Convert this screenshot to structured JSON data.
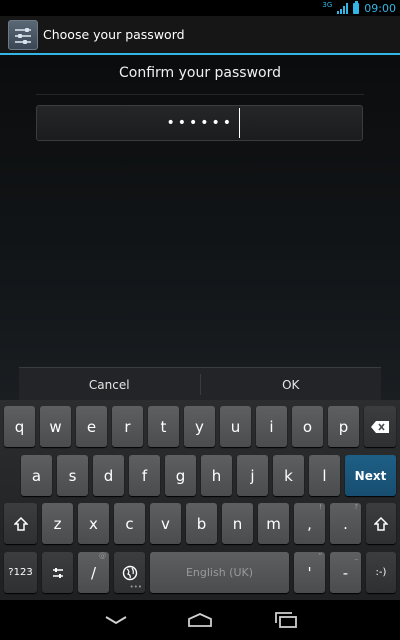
{
  "status_bar": {
    "network": "3G",
    "time": "09:00"
  },
  "action_bar": {
    "title": "Choose your password",
    "icon": "settings-sliders-icon"
  },
  "main": {
    "header": "Confirm your password",
    "password_masked": "••••••",
    "buttons": {
      "cancel": "Cancel",
      "ok": "OK"
    }
  },
  "keyboard": {
    "row1": [
      "q",
      "w",
      "e",
      "r",
      "t",
      "y",
      "u",
      "i",
      "o",
      "p"
    ],
    "row2": [
      "a",
      "s",
      "d",
      "f",
      "g",
      "h",
      "j",
      "k",
      "l"
    ],
    "row3": [
      "z",
      "x",
      "c",
      "v",
      "b",
      "n",
      "m"
    ],
    "next_label": "Next",
    "comma": ",",
    "period": ".",
    "row3_hint_comma": "!",
    "row3_hint_period": "?",
    "symbols_label": "?123",
    "slash": "/",
    "slash_hint": "@",
    "space_label": "English (UK)",
    "apostrophe": "'",
    "apostrophe_hint": "\"",
    "dash": "-",
    "dash_hint": "_",
    "smiley": ":-)"
  },
  "colors": {
    "accent": "#33b5e5",
    "next_key": "#1e5f86"
  }
}
